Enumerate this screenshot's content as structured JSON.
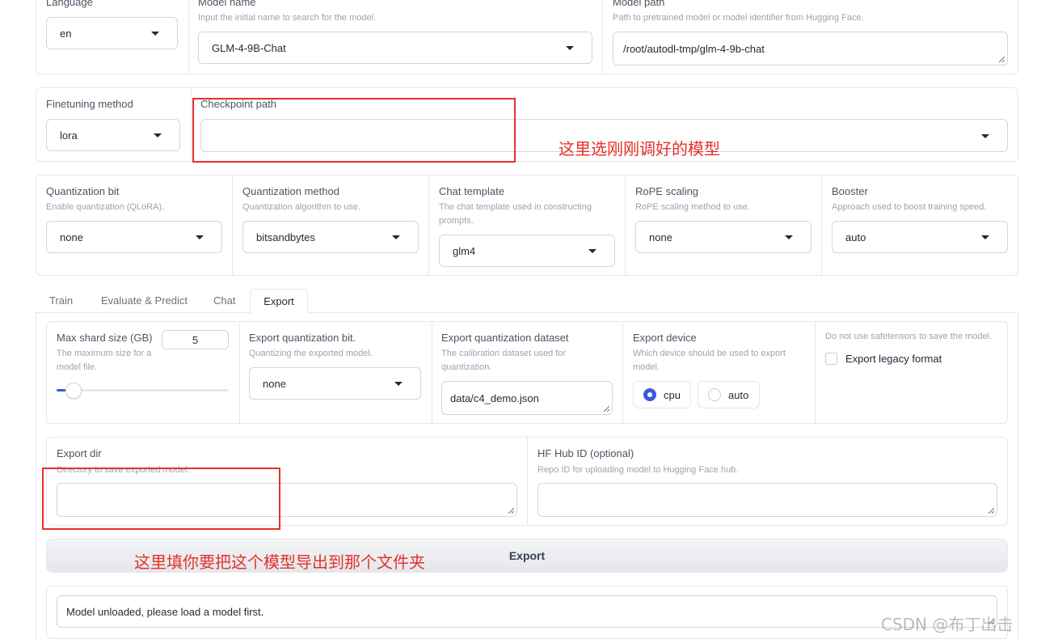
{
  "top_row": {
    "language": {
      "label": "Language",
      "value": "en"
    },
    "model_name": {
      "label": "Model name",
      "info": "Input the initial name to search for the model.",
      "value": "GLM-4-9B-Chat"
    },
    "model_path": {
      "label": "Model path",
      "info": "Path to pretrained model or model identifier from Hugging Face.",
      "value": "/root/autodl-tmp/glm-4-9b-chat"
    }
  },
  "finetune_row": {
    "finetuning_method": {
      "label": "Finetuning method",
      "value": "lora"
    },
    "checkpoint_path": {
      "label": "Checkpoint path",
      "value": ""
    }
  },
  "advanced_row": {
    "quantization_bit": {
      "label": "Quantization bit",
      "info": "Enable quantization (QLoRA).",
      "value": "none"
    },
    "quantization_method": {
      "label": "Quantization method",
      "info": "Quantization algorithm to use.",
      "value": "bitsandbytes"
    },
    "chat_template": {
      "label": "Chat template",
      "info": "The chat template used in constructing prompts.",
      "value": "glm4"
    },
    "rope_scaling": {
      "label": "RoPE scaling",
      "info": "RoPE scaling method to use.",
      "value": "none"
    },
    "booster": {
      "label": "Booster",
      "info": "Approach used to boost training speed.",
      "value": "auto"
    }
  },
  "tabs": [
    {
      "label": "Train"
    },
    {
      "label": "Evaluate & Predict"
    },
    {
      "label": "Chat"
    },
    {
      "label": "Export"
    }
  ],
  "export": {
    "max_shard": {
      "label": "Max shard size (GB)",
      "info": "The maximum size for a model file.",
      "value": "5",
      "slider_fraction": 0.04
    },
    "export_quant_bit": {
      "label": "Export quantization bit.",
      "info": "Quantizing the exported model.",
      "value": "none"
    },
    "export_quant_dataset": {
      "label": "Export quantization dataset",
      "info": "The calibration dataset used for quantization.",
      "value": "data/c4_demo.json"
    },
    "export_device": {
      "label": "Export device",
      "info": "Which device should be used to export model.",
      "options": [
        "cpu",
        "auto"
      ],
      "selected": "cpu"
    },
    "legacy": {
      "info": "Do not use safetensors to save the model.",
      "label": "Export legacy format",
      "checked": false
    },
    "export_dir": {
      "label": "Export dir",
      "info": "Directory to save exported model.",
      "value": ""
    },
    "hub_id": {
      "label": "HF Hub ID (optional)",
      "info": "Repo ID for uploading model to Hugging Face hub.",
      "value": ""
    },
    "button_label": "Export",
    "output": "Model unloaded, please load a model first."
  },
  "annotations": {
    "checkpoint_note": "这里选刚刚调好的模型",
    "export_dir_note": "这里填你要把这个模型导出到那个文件夹"
  },
  "watermark": "CSDN @布丁出击",
  "colors": {
    "accent": "#3b5bdb",
    "annotation_red": "#e5312a",
    "border": "#e5e7eb"
  }
}
